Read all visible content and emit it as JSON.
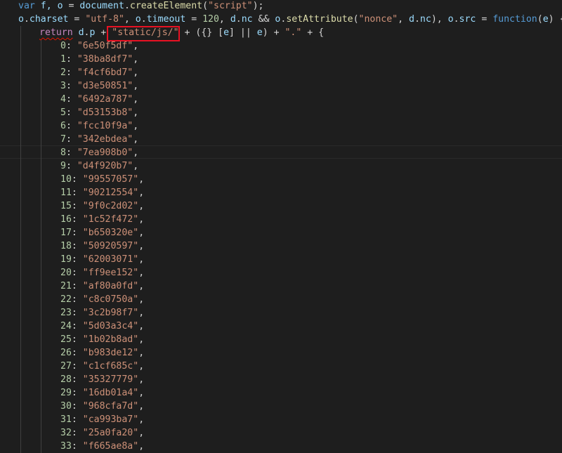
{
  "code": {
    "line1": {
      "kw": "var",
      "vars": "f, o",
      "eq": "=",
      "obj": "document",
      "method": "createElement",
      "arg": "\"script\""
    },
    "line2": {
      "obj": "o",
      "charset_prop": "charset",
      "charset_val": "\"utf-8\"",
      "timeout_prop": "timeout",
      "timeout_val": "120",
      "dnc_obj": "d",
      "dnc_prop": "nc",
      "op_and": "&&",
      "setattr": "setAttribute",
      "nonce_str": "\"nonce\"",
      "src_prop": "src",
      "fn_kw": "function",
      "param": "e"
    },
    "line3": {
      "ret": "return",
      "dp_obj": "d",
      "dp_prop": "p",
      "path_str": "\"static/js/\"",
      "rest_a": " + ({} [",
      "e1": "e",
      "rest_b": "] || ",
      "e2": "e",
      "rest_c": ") + ",
      "dot_str": "\".\"",
      "rest_d": " + {"
    },
    "entries": [
      {
        "key": "0",
        "hash": "\"6e50f5df\""
      },
      {
        "key": "1",
        "hash": "\"38ba8df7\""
      },
      {
        "key": "2",
        "hash": "\"f4cf6bd7\""
      },
      {
        "key": "3",
        "hash": "\"d3e50851\""
      },
      {
        "key": "4",
        "hash": "\"6492a787\""
      },
      {
        "key": "5",
        "hash": "\"d53153b8\""
      },
      {
        "key": "6",
        "hash": "\"fcc10f9a\""
      },
      {
        "key": "7",
        "hash": "\"342ebdea\""
      },
      {
        "key": "8",
        "hash": "\"7ea908b0\""
      },
      {
        "key": "9",
        "hash": "\"d4f920b7\""
      },
      {
        "key": "10",
        "hash": "\"99557057\""
      },
      {
        "key": "11",
        "hash": "\"90212554\""
      },
      {
        "key": "15",
        "hash": "\"9f0c2d02\""
      },
      {
        "key": "16",
        "hash": "\"1c52f472\""
      },
      {
        "key": "17",
        "hash": "\"b650320e\""
      },
      {
        "key": "18",
        "hash": "\"50920597\""
      },
      {
        "key": "19",
        "hash": "\"62003071\""
      },
      {
        "key": "20",
        "hash": "\"ff9ee152\""
      },
      {
        "key": "21",
        "hash": "\"af80a0fd\""
      },
      {
        "key": "22",
        "hash": "\"c8c0750a\""
      },
      {
        "key": "23",
        "hash": "\"3c2b98f7\""
      },
      {
        "key": "24",
        "hash": "\"5d03a3c4\""
      },
      {
        "key": "25",
        "hash": "\"1b02b8ad\""
      },
      {
        "key": "26",
        "hash": "\"b983de12\""
      },
      {
        "key": "27",
        "hash": "\"c1cf685c\""
      },
      {
        "key": "28",
        "hash": "\"35327779\""
      },
      {
        "key": "29",
        "hash": "\"16db01a4\""
      },
      {
        "key": "30",
        "hash": "\"968cfa7d\""
      },
      {
        "key": "31",
        "hash": "\"ca993ba7\""
      },
      {
        "key": "32",
        "hash": "\"25a0fa20\""
      },
      {
        "key": "33",
        "hash": "\"f665ae8a\""
      }
    ]
  },
  "theme": {
    "background": "#1e1e1e",
    "keyword": "#569cd6",
    "control": "#c586c0",
    "variable": "#9cdcfe",
    "function": "#dcdcaa",
    "string": "#ce9178",
    "number": "#b5cea8",
    "highlight_box": "#e81123"
  }
}
